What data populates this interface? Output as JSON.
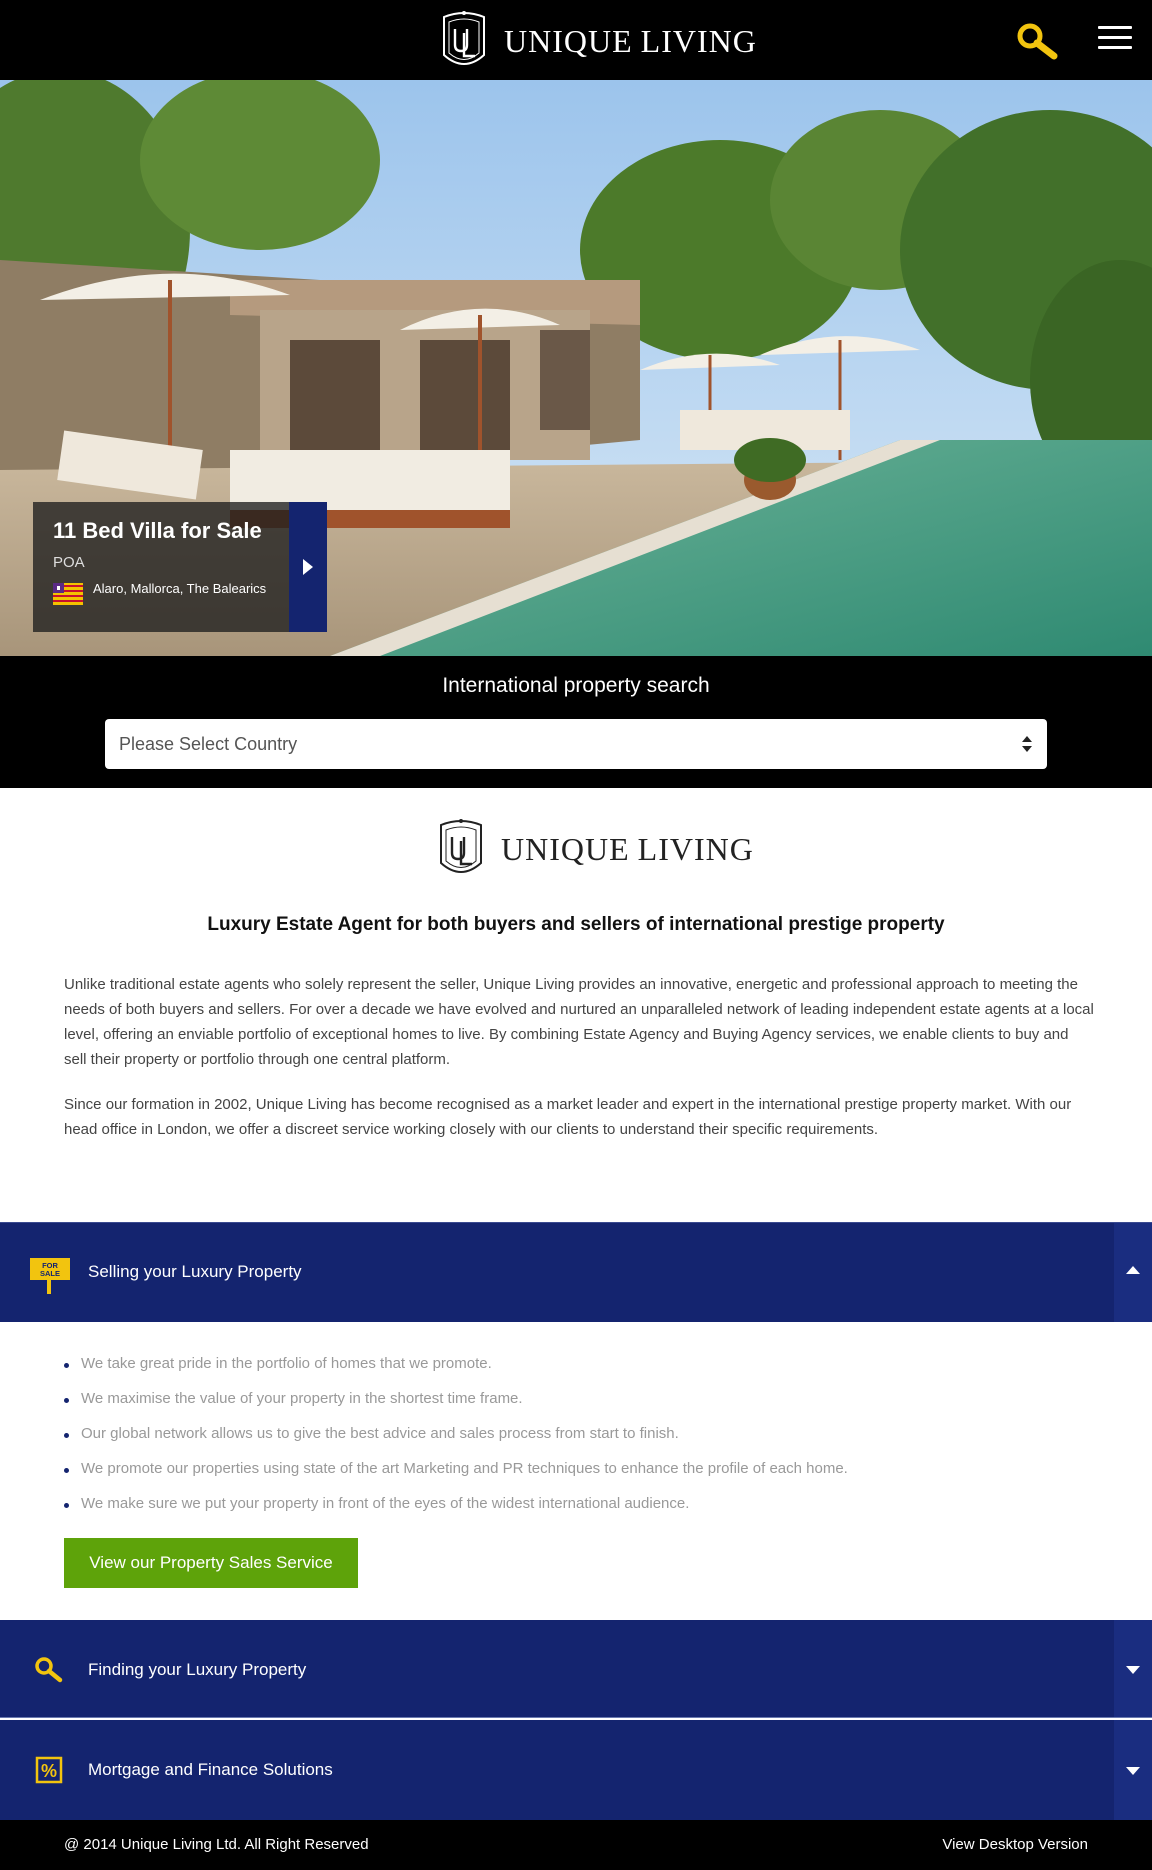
{
  "header": {
    "brand_line1": "Unique",
    "brand_line2": "Living"
  },
  "hero": {
    "title": "11 Bed Villa for Sale",
    "price": "POA",
    "location": "Alaro, Mallorca, The Balearics",
    "flag": "mallorca-flag"
  },
  "search": {
    "title": "International property search",
    "placeholder": "Please Select Country"
  },
  "intro": {
    "tagline": "Luxury Estate Agent for both buyers and sellers of international prestige property",
    "paragraph1": "Unlike traditional estate agents who solely represent the seller, Unique Living provides an innovative, energetic and professional approach to meeting the needs of both buyers and sellers. For over a decade we have evolved and nurtured an unparalleled network of leading independent estate agents at a local level, offering an enviable portfolio of exceptional homes to live. By combining Estate Agency and Buying Agency services, we enable clients to buy and sell their property or portfolio through one central platform.",
    "paragraph2": "Since our formation in 2002, Unique Living has become recognised as a market leader and expert in the international prestige property market. With our head office in London, we offer a discreet service working closely with our clients to understand their specific requirements."
  },
  "accordion": [
    {
      "label": "Selling your Luxury Property",
      "icon": "for-sale-sign-icon",
      "icon_text_1": "FOR",
      "icon_text_2": "SALE",
      "expanded": true,
      "bullets": [
        "We take great pride in the portfolio of homes that we promote.",
        "We maximise the value of your property in the shortest time frame.",
        "Our global network allows us to give the best advice and sales process from start to finish.",
        "We promote our properties using state of the art Marketing and PR techniques to enhance the profile of each home.",
        "We make sure we put your property in front of the eyes of the widest international audience."
      ],
      "cta": "View our Property Sales Service"
    },
    {
      "label": "Finding your Luxury Property",
      "icon": "search-icon",
      "expanded": false
    },
    {
      "label": "Mortgage and Finance Solutions",
      "icon": "percent-icon",
      "icon_text": "%",
      "expanded": false
    }
  ],
  "footer": {
    "copyright": "@ 2014 Unique Living Ltd. All Right Reserved",
    "desktop_link": "View Desktop Version"
  },
  "colors": {
    "navy": "#14246f",
    "gold": "#f2c40f",
    "green": "#5ea30a"
  }
}
